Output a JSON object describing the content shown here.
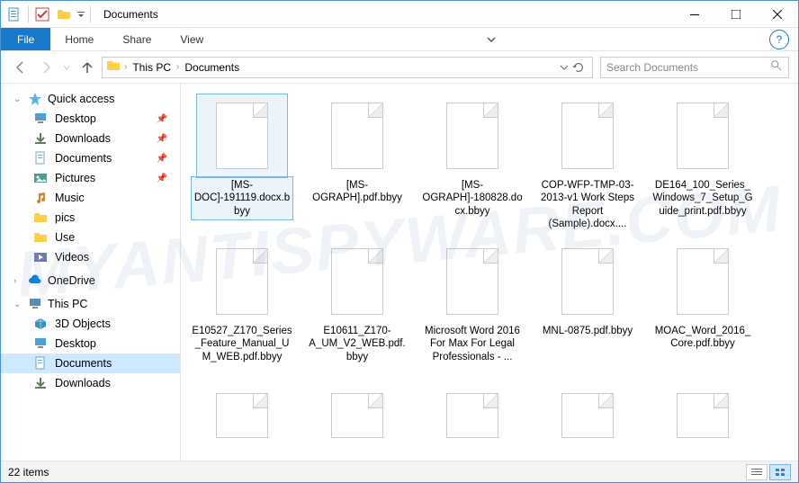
{
  "window": {
    "title": "Documents"
  },
  "ribbon": {
    "file": "File",
    "tabs": [
      "Home",
      "Share",
      "View"
    ]
  },
  "address": {
    "crumbs": [
      "This PC",
      "Documents"
    ]
  },
  "search": {
    "placeholder": "Search Documents"
  },
  "navpane": {
    "quick_access": {
      "label": "Quick access",
      "items": [
        {
          "label": "Desktop",
          "icon": "desktop",
          "pinned": true
        },
        {
          "label": "Downloads",
          "icon": "downloads",
          "pinned": true
        },
        {
          "label": "Documents",
          "icon": "documents",
          "pinned": true
        },
        {
          "label": "Pictures",
          "icon": "pictures",
          "pinned": true
        },
        {
          "label": "Music",
          "icon": "music",
          "pinned": false
        },
        {
          "label": "pics",
          "icon": "folder",
          "pinned": false
        },
        {
          "label": "Use",
          "icon": "folder",
          "pinned": false
        },
        {
          "label": "Videos",
          "icon": "videos",
          "pinned": false
        }
      ]
    },
    "onedrive": {
      "label": "OneDrive"
    },
    "this_pc": {
      "label": "This PC",
      "items": [
        {
          "label": "3D Objects",
          "icon": "3d"
        },
        {
          "label": "Desktop",
          "icon": "desktop"
        },
        {
          "label": "Documents",
          "icon": "documents",
          "selected": true
        },
        {
          "label": "Downloads",
          "icon": "downloads"
        }
      ]
    }
  },
  "files": [
    {
      "name": "[MS-DOC]-191119.docx.bbyy",
      "selected": true
    },
    {
      "name": "[MS-OGRAPH].pdf.bbyy"
    },
    {
      "name": "[MS-OGRAPH]-180828.docx.bbyy"
    },
    {
      "name": "COP-WFP-TMP-03-2013-v1 Work Steps Report (Sample).docx...."
    },
    {
      "name": "DE164_100_Series_Windows_7_Setup_Guide_print.pdf.bbyy"
    },
    {
      "name": "E10527_Z170_Series_Feature_Manual_UM_WEB.pdf.bbyy"
    },
    {
      "name": "E10611_Z170-A_UM_V2_WEB.pdf.bbyy"
    },
    {
      "name": "Microsoft Word 2016 For Max For Legal Professionals - ..."
    },
    {
      "name": "MNL-0875.pdf.bbyy"
    },
    {
      "name": "MOAC_Word_2016_Core.pdf.bbyy"
    }
  ],
  "statusbar": {
    "count_text": "22 items"
  },
  "watermark": "MYANTISPYWARE.COM"
}
